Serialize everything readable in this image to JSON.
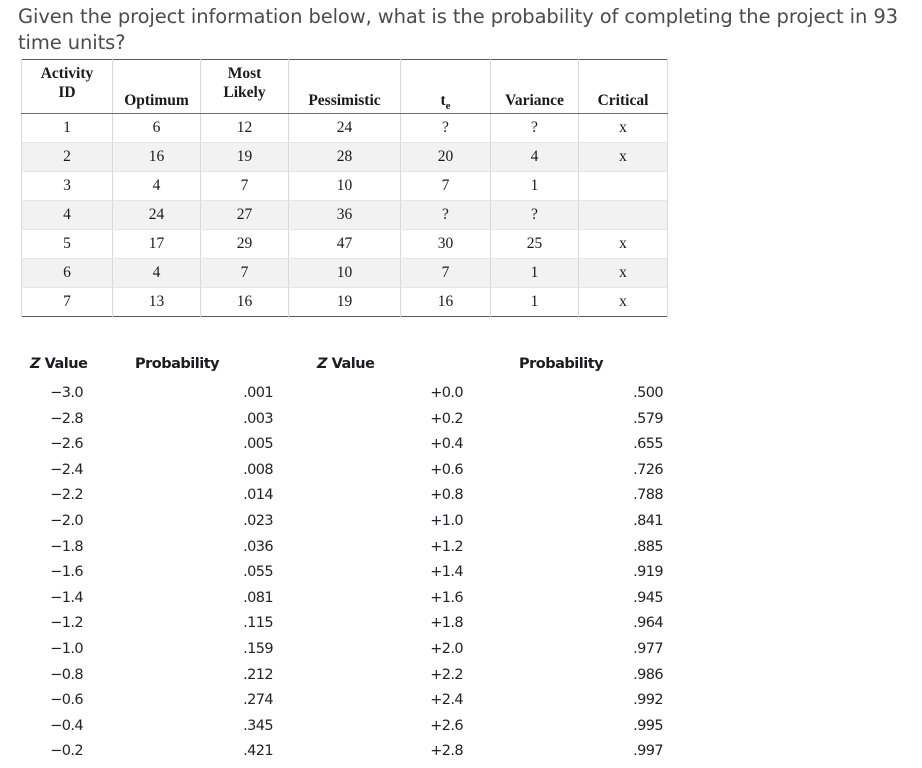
{
  "question": "Given the project information below, what is the probability of completing the project in 93 time units?",
  "activity_table": {
    "headers": {
      "activity_id_line1": "Activity",
      "activity_id_line2": "ID",
      "optimum": "Optimum",
      "most_likely_line1": "Most",
      "most_likely_line2": "Likely",
      "pessimistic": "Pessimistic",
      "te_base": "t",
      "te_sub": "e",
      "variance": "Variance",
      "critical": "Critical"
    },
    "rows": [
      {
        "id": "1",
        "optimum": "6",
        "most_likely": "12",
        "pessimistic": "24",
        "te": "?",
        "variance": "?",
        "critical": "x"
      },
      {
        "id": "2",
        "optimum": "16",
        "most_likely": "19",
        "pessimistic": "28",
        "te": "20",
        "variance": "4",
        "critical": "x"
      },
      {
        "id": "3",
        "optimum": "4",
        "most_likely": "7",
        "pessimistic": "10",
        "te": "7",
        "variance": "1",
        "critical": ""
      },
      {
        "id": "4",
        "optimum": "24",
        "most_likely": "27",
        "pessimistic": "36",
        "te": "?",
        "variance": "?",
        "critical": ""
      },
      {
        "id": "5",
        "optimum": "17",
        "most_likely": "29",
        "pessimistic": "47",
        "te": "30",
        "variance": "25",
        "critical": "x"
      },
      {
        "id": "6",
        "optimum": "4",
        "most_likely": "7",
        "pessimistic": "10",
        "te": "7",
        "variance": "1",
        "critical": "x"
      },
      {
        "id": "7",
        "optimum": "13",
        "most_likely": "16",
        "pessimistic": "19",
        "te": "16",
        "variance": "1",
        "critical": "x"
      }
    ]
  },
  "z_table": {
    "headers": {
      "z_value_left": "Z Value",
      "probability_left": "Probability",
      "z_value_right": "Z Value",
      "probability_right": "Probability"
    },
    "rows": [
      {
        "z_neg": "−3.0",
        "p_neg": ".001",
        "z_pos": "+0.0",
        "p_pos": ".500"
      },
      {
        "z_neg": "−2.8",
        "p_neg": ".003",
        "z_pos": "+0.2",
        "p_pos": ".579"
      },
      {
        "z_neg": "−2.6",
        "p_neg": ".005",
        "z_pos": "+0.4",
        "p_pos": ".655"
      },
      {
        "z_neg": "−2.4",
        "p_neg": ".008",
        "z_pos": "+0.6",
        "p_pos": ".726"
      },
      {
        "z_neg": "−2.2",
        "p_neg": ".014",
        "z_pos": "+0.8",
        "p_pos": ".788"
      },
      {
        "z_neg": "−2.0",
        "p_neg": ".023",
        "z_pos": "+1.0",
        "p_pos": ".841"
      },
      {
        "z_neg": "−1.8",
        "p_neg": ".036",
        "z_pos": "+1.2",
        "p_pos": ".885"
      },
      {
        "z_neg": "−1.6",
        "p_neg": ".055",
        "z_pos": "+1.4",
        "p_pos": ".919"
      },
      {
        "z_neg": "−1.4",
        "p_neg": ".081",
        "z_pos": "+1.6",
        "p_pos": ".945"
      },
      {
        "z_neg": "−1.2",
        "p_neg": ".115",
        "z_pos": "+1.8",
        "p_pos": ".964"
      },
      {
        "z_neg": "−1.0",
        "p_neg": ".159",
        "z_pos": "+2.0",
        "p_pos": ".977"
      },
      {
        "z_neg": "−0.8",
        "p_neg": ".212",
        "z_pos": "+2.2",
        "p_pos": ".986"
      },
      {
        "z_neg": "−0.6",
        "p_neg": ".274",
        "z_pos": "+2.4",
        "p_pos": ".992"
      },
      {
        "z_neg": "−0.4",
        "p_neg": ".345",
        "z_pos": "+2.6",
        "p_pos": ".995"
      },
      {
        "z_neg": "−0.2",
        "p_neg": ".421",
        "z_pos": "+2.8",
        "p_pos": ".997"
      }
    ]
  },
  "colors": {
    "question_text": "#4b4b4b",
    "table_border": "#58595b",
    "row_stripe": "#f2f2f2",
    "text": "#1a1a1a"
  }
}
